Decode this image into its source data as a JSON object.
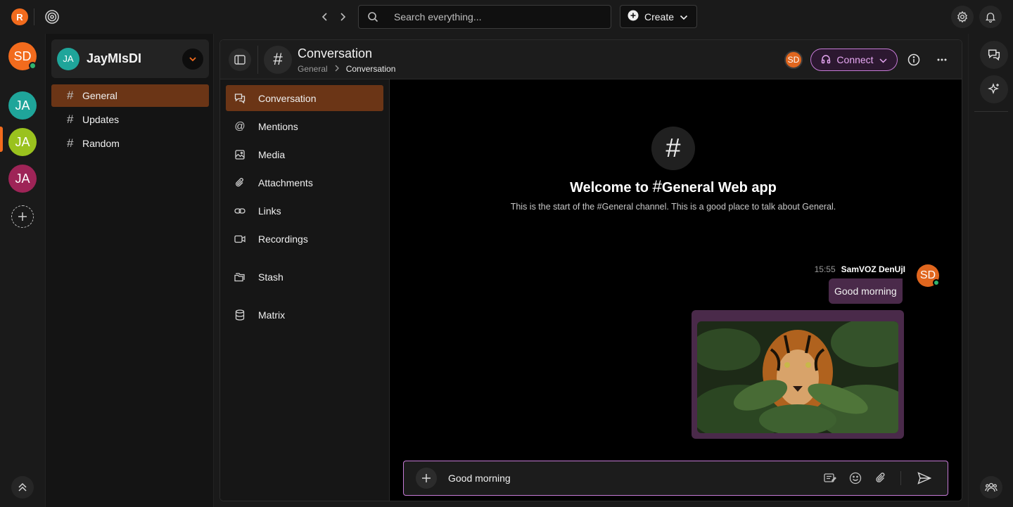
{
  "topbar": {
    "logo_letter": "R",
    "search_placeholder": "Search everything...",
    "create_label": "Create",
    "icons": [
      "radar-icon",
      "chevron-left-icon",
      "chevron-right-icon",
      "search-icon",
      "plus-circle-icon",
      "settings-icon",
      "bell-icon"
    ]
  },
  "rail": {
    "user_initials": "SD",
    "workspaces": [
      {
        "initials": "JA",
        "color": "#1fa59a"
      },
      {
        "initials": "JA",
        "color": "#9ac21e"
      },
      {
        "initials": "JA",
        "color": "#9e2457"
      }
    ],
    "accent": "#f26b1d"
  },
  "workspace": {
    "initials": "JA",
    "name": "JayMIsDI",
    "channels": [
      {
        "label": "General",
        "active": true
      },
      {
        "label": "Updates",
        "active": false
      },
      {
        "label": "Random",
        "active": false
      }
    ]
  },
  "header": {
    "title": "Conversation",
    "breadcrumb_parent": "General",
    "breadcrumb_current": "Conversation",
    "avatar_initials": "SD",
    "connect_label": "Connect"
  },
  "subnav": {
    "items": [
      {
        "label": "Conversation",
        "icon": "chat-icon"
      },
      {
        "label": "Mentions",
        "icon": "at-icon"
      },
      {
        "label": "Media",
        "icon": "image-icon"
      },
      {
        "label": "Attachments",
        "icon": "paperclip-icon"
      },
      {
        "label": "Links",
        "icon": "link-icon"
      },
      {
        "label": "Recordings",
        "icon": "video-icon"
      },
      {
        "label": "Stash",
        "icon": "folders-icon"
      },
      {
        "label": "Matrix",
        "icon": "database-icon"
      }
    ]
  },
  "chat": {
    "welcome_prefix": "Welcome to",
    "welcome_hash": "#",
    "welcome_channel": "General Web app",
    "welcome_sub": "This is the start of the #General channel. This is a good place to talk about General.",
    "message": {
      "time": "15:55",
      "author": "SamVOZ DenUjI",
      "text": "Good morning",
      "avatar_initials": "SD"
    },
    "composer_value": "Good morning"
  }
}
